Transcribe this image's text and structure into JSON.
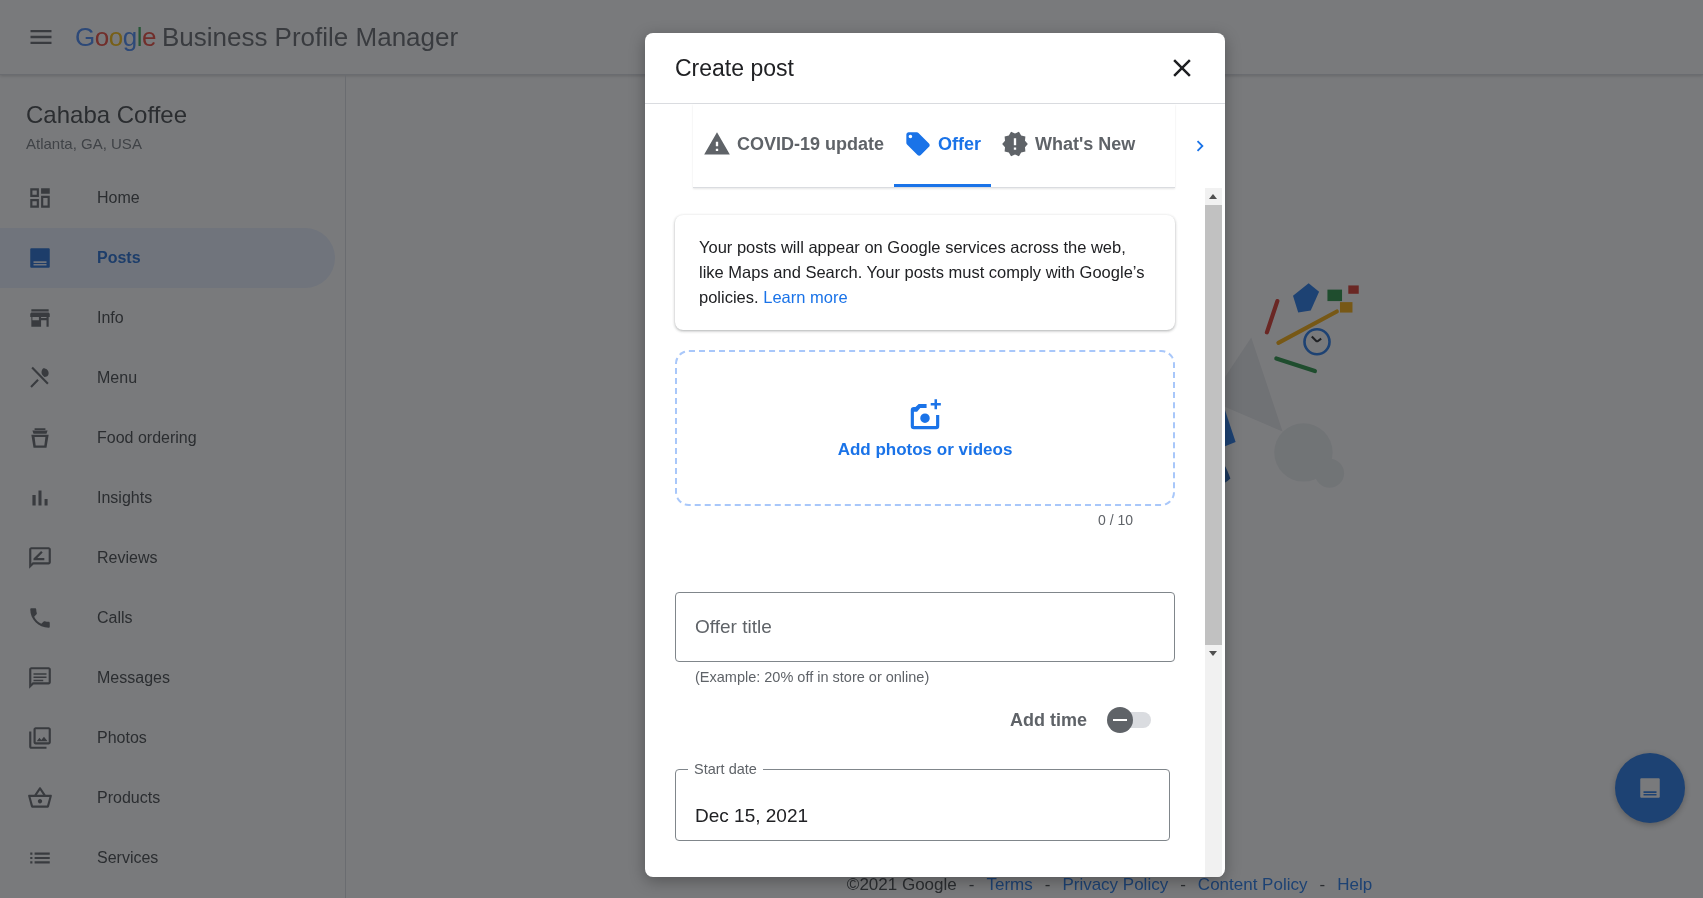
{
  "header": {
    "logo_brand": "Google",
    "product": "Business Profile Manager"
  },
  "business": {
    "name": "Cahaba Coffee",
    "location": "Atlanta, GA, USA"
  },
  "sidebar": {
    "items": [
      {
        "label": "Home",
        "selected": false
      },
      {
        "label": "Posts",
        "selected": true
      },
      {
        "label": "Info",
        "selected": false
      },
      {
        "label": "Menu",
        "selected": false
      },
      {
        "label": "Food ordering",
        "selected": false
      },
      {
        "label": "Insights",
        "selected": false
      },
      {
        "label": "Reviews",
        "selected": false
      },
      {
        "label": "Calls",
        "selected": false
      },
      {
        "label": "Messages",
        "selected": false
      },
      {
        "label": "Photos",
        "selected": false
      },
      {
        "label": "Products",
        "selected": false
      },
      {
        "label": "Services",
        "selected": false
      }
    ]
  },
  "footer": [
    {
      "kind": "text",
      "label": "©2021 Google"
    },
    {
      "kind": "separator",
      "label": "-"
    },
    {
      "kind": "link",
      "label": "Terms"
    },
    {
      "kind": "separator",
      "label": "-"
    },
    {
      "kind": "link",
      "label": "Privacy Policy"
    },
    {
      "kind": "separator",
      "label": "-"
    },
    {
      "kind": "link",
      "label": "Content Policy"
    },
    {
      "kind": "separator",
      "label": "-"
    },
    {
      "kind": "link",
      "label": "Help"
    }
  ],
  "dialog": {
    "title": "Create post",
    "tabs": [
      {
        "label": "COVID-19 update",
        "selected": false
      },
      {
        "label": "Offer",
        "selected": true
      },
      {
        "label": "What's New",
        "selected": false
      }
    ],
    "notice": {
      "text": "Your posts will appear on Google services across the web, like Maps and Search. Your posts must comply with Google’s policies.",
      "link": "Learn more"
    },
    "media": {
      "label": "Add photos or videos",
      "count": "0 / 10"
    },
    "offer_title": {
      "placeholder": "Offer title",
      "hint": "(Example: 20% off in store or online)"
    },
    "add_time": {
      "label": "Add time",
      "on": false
    },
    "start_date": {
      "label": "Start date",
      "value": "Dec 15, 2021"
    }
  }
}
